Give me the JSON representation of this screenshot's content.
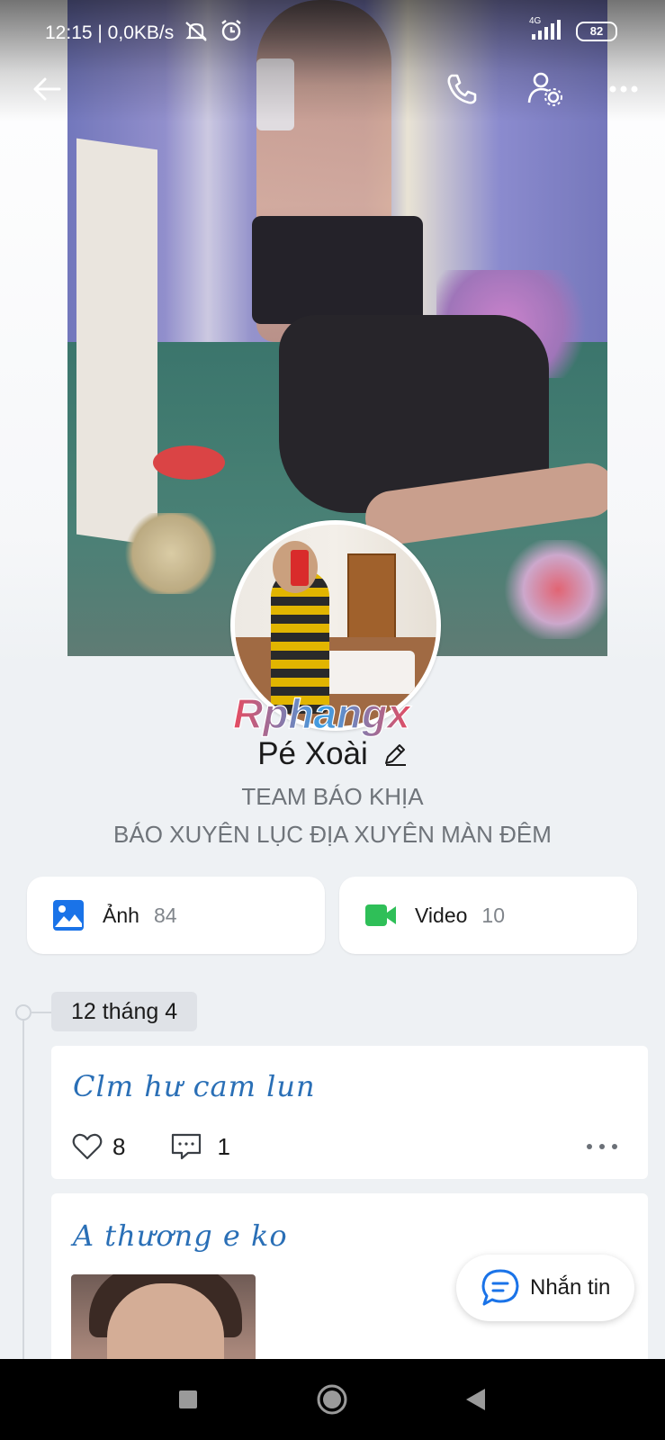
{
  "status_bar": {
    "time_and_speed": "12:15 | 0,0KB/s",
    "network": "4G",
    "battery": "82"
  },
  "header": {
    "icons": [
      "back-arrow-icon",
      "phone-icon",
      "profile-settings-icon",
      "more-icon"
    ]
  },
  "watermark": "Rphangx",
  "profile": {
    "name": "Pé Xoài",
    "bio_line_1": "TEAM BÁO KHỊA",
    "bio_line_2": "BÁO XUYÊN LỤC ĐỊA XUYÊN MÀN ĐÊM"
  },
  "media": {
    "photos": {
      "label": "Ảnh",
      "count": "84",
      "icon": "image-icon",
      "color": "#1a73e8"
    },
    "videos": {
      "label": "Video",
      "count": "10",
      "icon": "video-camera-icon",
      "color": "#2fbf58"
    }
  },
  "timeline": {
    "date": "12 tháng 4",
    "posts": [
      {
        "text": "Clm hư cam lun",
        "likes": "8",
        "comments": "1"
      },
      {
        "text": "A thương e ko"
      }
    ]
  },
  "message_button": {
    "label": "Nhắn tin",
    "color": "#1a73e8"
  }
}
